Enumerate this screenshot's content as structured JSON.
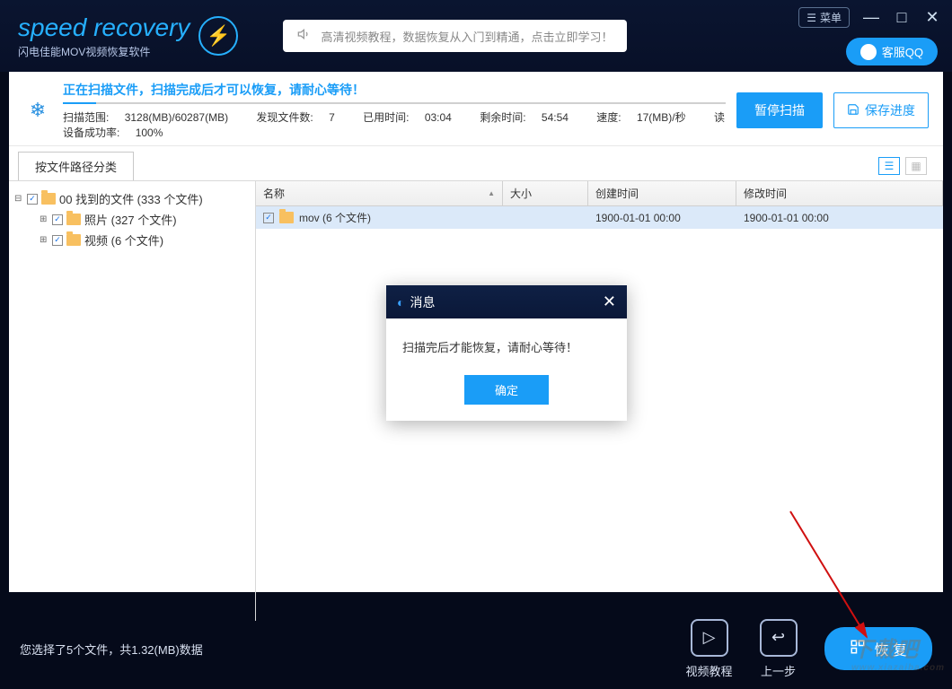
{
  "titlebar": {
    "logo_text": "speed recovery",
    "logo_sub": "闪电佳能MOV视频恢复软件",
    "menu_label": "菜单",
    "qq_label": "客服QQ"
  },
  "tutorial": {
    "text": "高清视频教程，数据恢复从入门到精通，点击立即学习！"
  },
  "scan": {
    "title": "正在扫描文件，扫描完成后才可以恢复，请耐心等待！",
    "range_label": "扫描范围:",
    "range_value": "3128(MB)/60287(MB)",
    "found_label": "发现文件数:",
    "found_value": "7",
    "elapsed_label": "已用时间:",
    "elapsed_value": "03:04",
    "remain_label": "剩余时间:",
    "remain_value": "54:54",
    "speed_label": "速度:",
    "speed_value": "17(MB)/秒",
    "device_label": "读设备成功率:",
    "device_value": "100%",
    "pause_btn": "暂停扫描",
    "save_btn": "保存进度"
  },
  "tab": {
    "label": "按文件路径分类"
  },
  "tree": {
    "root": "00 找到的文件  (333 个文件)",
    "photos": "照片    (327 个文件)",
    "videos": "视频    (6 个文件)"
  },
  "columns": {
    "name": "名称",
    "size": "大小",
    "create": "创建时间",
    "modify": "修改时间"
  },
  "row": {
    "name": "mov    (6 个文件)",
    "create": "1900-01-01  00:00",
    "modify": "1900-01-01  00:00"
  },
  "dialog": {
    "title": "消息",
    "body": "扫描完后才能恢复，请耐心等待！",
    "ok": "确定"
  },
  "footer": {
    "selection": "您选择了5个文件，共1.32(MB)数据",
    "tutorial": "视频教程",
    "back": "上一步",
    "recover": "恢 复"
  },
  "watermark": {
    "main": "下载吧",
    "sub": "www.xiazaiba.com"
  }
}
